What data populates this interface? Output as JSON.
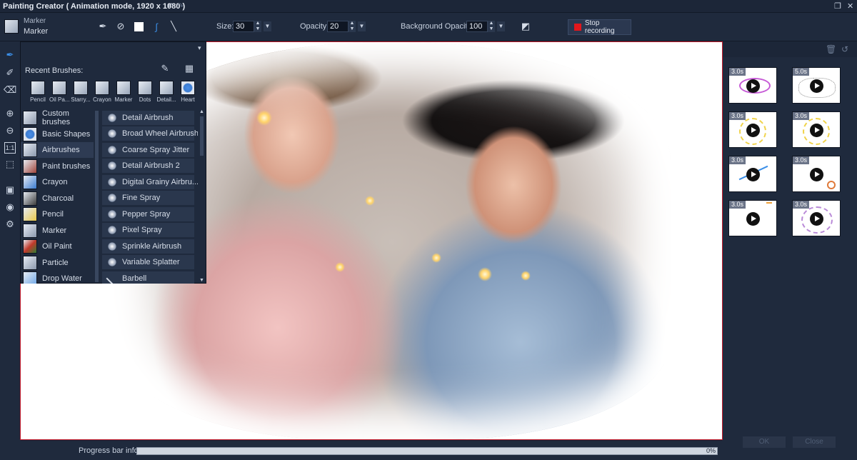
{
  "window": {
    "title": "Painting Creator ( Animation mode, 1920 x 1080 )",
    "undo_icon": "undo-icon",
    "redo_icon": "redo-icon",
    "restore_icon": "restore-window-icon",
    "close_icon": "close-icon"
  },
  "toolbar": {
    "brush_category": "Marker",
    "brush_name": "Marker",
    "size_label": "Size:",
    "size_value": "30",
    "opacity_label": "Opacity:",
    "opacity_value": "20",
    "bg_opacity_label": "Background Opacity:",
    "bg_opacity_value": "100",
    "stop_recording_label": "Stop recording",
    "record_color": "#e2171c"
  },
  "recent_brushes": {
    "label": "Recent Brushes:",
    "items": [
      "Pencil",
      "Oil Pa...",
      "Starry...",
      "Crayon",
      "Marker",
      "Dots",
      "Detail...",
      "Heart"
    ]
  },
  "brush_categories": {
    "items": [
      "Custom brushes",
      "Basic Shapes",
      "Airbrushes",
      "Paint brushes",
      "Crayon",
      "Charcoal",
      "Pencil",
      "Marker",
      "Oil Paint",
      "Particle",
      "Drop Water"
    ],
    "selected": "Airbrushes"
  },
  "brush_presets": {
    "items": [
      "Detail Airbrush",
      "Broad Wheel Airbrush",
      "Coarse Spray Jitter",
      "Detail Airbrush 2",
      "Digital Grainy Airbru...",
      "Fine Spray",
      "Pepper Spray",
      "Pixel Spray",
      "Sprinkle Airbrush",
      "Variable Splatter",
      "Barbell"
    ]
  },
  "clips": {
    "items": [
      {
        "duration": "3.0s"
      },
      {
        "duration": "5.0s"
      },
      {
        "duration": "3.0s"
      },
      {
        "duration": "3.0s"
      },
      {
        "duration": "3.0s"
      },
      {
        "duration": "3.0s"
      },
      {
        "duration": "3.0s"
      },
      {
        "duration": "3.0s"
      }
    ]
  },
  "dialog": {
    "ok_label": "OK",
    "close_label": "Close"
  },
  "progress": {
    "label": "Progress bar info",
    "percent_text": "0%",
    "value": 0
  },
  "colors": {
    "canvas_border": "#c41a2b",
    "panel_bg": "#1f2a3d",
    "progress_fill": "#3a7bd5"
  }
}
